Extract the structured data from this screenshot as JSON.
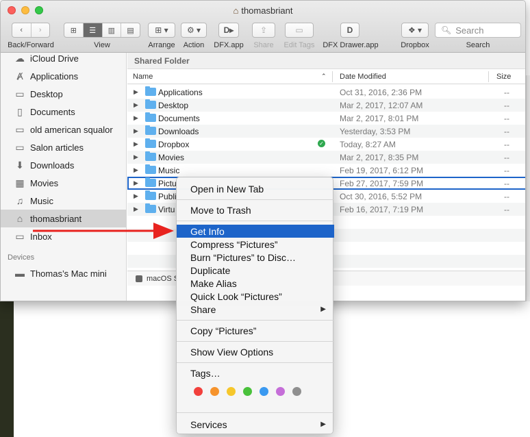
{
  "window": {
    "title": "thomasbriant"
  },
  "toolbar": {
    "back_forward_label": "Back/Forward",
    "view_label": "View",
    "arrange_label": "Arrange",
    "action_label": "Action",
    "dfx_label": "DFX.app",
    "share_label": "Share",
    "edit_tags_label": "Edit Tags",
    "dfx_drawer_label": "DFX Drawer.app",
    "dropbox_label": "Dropbox",
    "search_label": "Search",
    "search_placeholder": "Search"
  },
  "sidebar": {
    "items": [
      {
        "label": "iCloud Drive",
        "icon": "cloud-icon"
      },
      {
        "label": "Applications",
        "icon": "applications-icon"
      },
      {
        "label": "Desktop",
        "icon": "desktop-icon"
      },
      {
        "label": "Documents",
        "icon": "documents-icon"
      },
      {
        "label": "old american squalor",
        "icon": "folder-icon"
      },
      {
        "label": "Salon articles",
        "icon": "folder-icon"
      },
      {
        "label": "Downloads",
        "icon": "downloads-icon"
      },
      {
        "label": "Movies",
        "icon": "movies-icon"
      },
      {
        "label": "Music",
        "icon": "music-icon"
      },
      {
        "label": "thomasbriant",
        "icon": "home-icon"
      },
      {
        "label": "Inbox",
        "icon": "folder-icon"
      }
    ],
    "devices_header": "Devices",
    "device": "Thomas’s Mac mini"
  },
  "main": {
    "shared_folder_label": "Shared Folder",
    "columns": {
      "name": "Name",
      "date_modified": "Date Modified",
      "size": "Size"
    },
    "rows": [
      {
        "name": "Applications",
        "date": "Oct 31, 2016, 2:36 PM",
        "size": "--"
      },
      {
        "name": "Desktop",
        "date": "Mar 2, 2017, 12:07 AM",
        "size": "--"
      },
      {
        "name": "Documents",
        "date": "Mar 2, 2017, 8:01 PM",
        "size": "--"
      },
      {
        "name": "Downloads",
        "date": "Yesterday, 3:53 PM",
        "size": "--"
      },
      {
        "name": "Dropbox",
        "date": "Today, 8:27 AM",
        "size": "--"
      },
      {
        "name": "Movies",
        "date": "Mar 2, 2017, 8:35 PM",
        "size": "--"
      },
      {
        "name": "Music",
        "date": "Feb 19, 2017, 6:12 PM",
        "size": "--"
      },
      {
        "name": "Pictu",
        "date": "Feb 27, 2017, 7:59 PM",
        "size": "--"
      },
      {
        "name": "Publi",
        "date": "Oct 30, 2016, 5:52 PM",
        "size": "--"
      },
      {
        "name": "Virtu",
        "date": "Feb 16, 2017, 7:19 PM",
        "size": "--"
      }
    ],
    "pathbar": "macOS S"
  },
  "context_menu": {
    "open_new_tab": "Open in New Tab",
    "move_to_trash": "Move to Trash",
    "get_info": "Get Info",
    "compress": "Compress “Pictures”",
    "burn": "Burn “Pictures” to Disc…",
    "duplicate": "Duplicate",
    "make_alias": "Make Alias",
    "quick_look": "Quick Look “Pictures”",
    "share": "Share",
    "copy": "Copy “Pictures”",
    "show_view_options": "Show View Options",
    "tags": "Tags…",
    "services": "Services",
    "tag_colors": [
      "#f2403c",
      "#f6932c",
      "#f6c72b",
      "#49c13b",
      "#3a99f0",
      "#c56ed8",
      "#8f8f8f"
    ]
  },
  "annotation_color": "#e8231f"
}
